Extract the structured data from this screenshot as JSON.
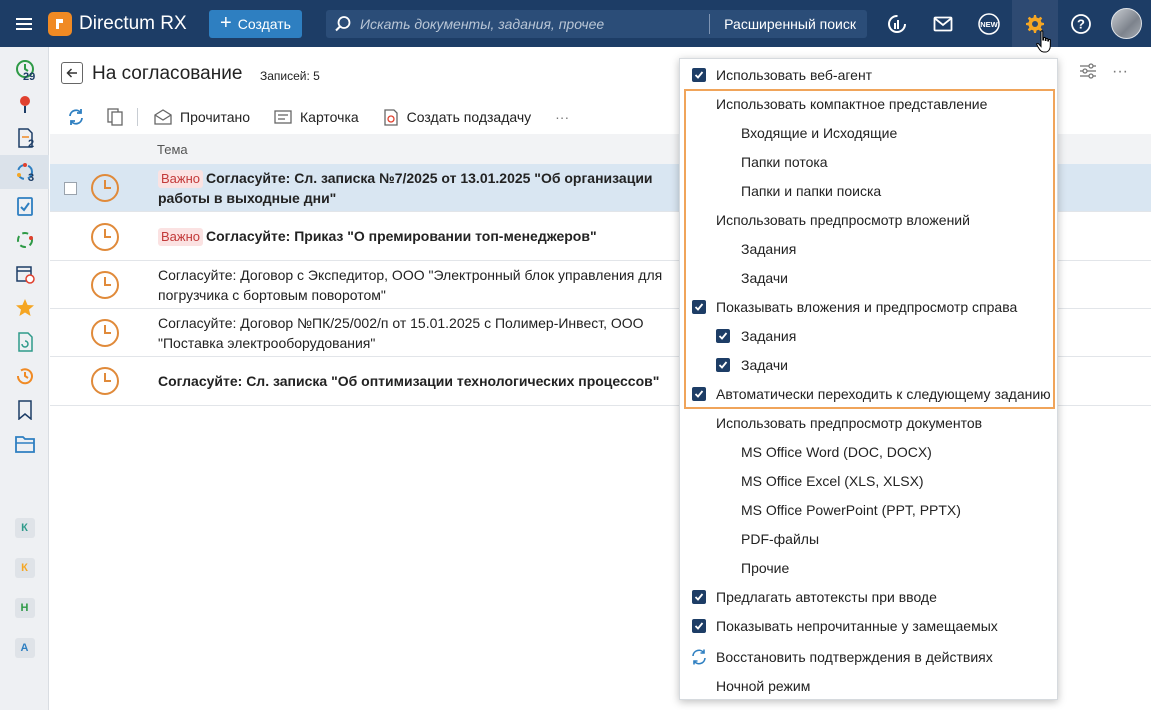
{
  "app": {
    "name": "Directum RX"
  },
  "topbar": {
    "create_label": "Создать",
    "search_placeholder": "Искать документы, задания, прочее",
    "advanced_search_label": "Расширенный поиск",
    "new_badge": "NEW"
  },
  "sidebar": {
    "badges": {
      "tasks": "29",
      "documents": "2",
      "approvals": "3"
    },
    "letters": [
      "К",
      "К",
      "Н",
      "А"
    ]
  },
  "main": {
    "title": "На согласование",
    "record_count": "Записей: 5",
    "toolbar": {
      "read_label": "Прочитано",
      "card_label": "Карточка",
      "subtask_label": "Создать подзадачу",
      "more_label": "···"
    },
    "column_subject": "Тема",
    "rows": [
      {
        "important": "Важно",
        "subject": "Согласуйте: Сл. записка №7/2025 от 13.01.2025 \"Об организации работы в выходные дни\"",
        "bold": true,
        "selected": true
      },
      {
        "important": "Важно",
        "subject": "Согласуйте: Приказ \"О премировании топ-менеджеров\"",
        "bold": true,
        "selected": false
      },
      {
        "important": "",
        "subject": "Согласуйте: Договор с Экспедитор, ООО \"Электронный блок управления для погрузчика с бортовым поворотом\"",
        "bold": false,
        "selected": false
      },
      {
        "important": "",
        "subject": "Согласуйте: Договор №ПК/25/002/п от 15.01.2025 с Полимер-Инвест, ООО \"Поставка электрооборудования\"",
        "bold": false,
        "selected": false
      },
      {
        "important": "",
        "subject": "Согласуйте: Сл. записка \"Об оптимизации технологических процессов\"",
        "bold": true,
        "selected": false
      }
    ]
  },
  "settings_menu": {
    "items": [
      {
        "label": "Использовать веб-агент",
        "checked": true,
        "indent": 0
      },
      {
        "label": "Использовать компактное представление",
        "checked": false,
        "indent": 0
      },
      {
        "label": "Входящие и Исходящие",
        "checked": false,
        "indent": 1
      },
      {
        "label": "Папки потока",
        "checked": false,
        "indent": 1
      },
      {
        "label": "Папки и папки поиска",
        "checked": false,
        "indent": 1
      },
      {
        "label": "Использовать предпросмотр вложений",
        "checked": false,
        "indent": 0
      },
      {
        "label": "Задания",
        "checked": false,
        "indent": 1
      },
      {
        "label": "Задачи",
        "checked": false,
        "indent": 1
      },
      {
        "label": "Показывать вложения и предпросмотр справа",
        "checked": true,
        "indent": 0
      },
      {
        "label": "Задания",
        "checked": true,
        "indent": 1
      },
      {
        "label": "Задачи",
        "checked": true,
        "indent": 1
      },
      {
        "label": "Автоматически переходить к следующему заданию",
        "checked": true,
        "indent": 0
      },
      {
        "label": "Использовать предпросмотр документов",
        "checked": false,
        "indent": 0
      },
      {
        "label": "MS Office Word (DOC, DOCX)",
        "checked": false,
        "indent": 1
      },
      {
        "label": "MS Office Excel (XLS, XLSX)",
        "checked": false,
        "indent": 1
      },
      {
        "label": "MS Office PowerPoint (PPT, PPTX)",
        "checked": false,
        "indent": 1
      },
      {
        "label": "PDF-файлы",
        "checked": false,
        "indent": 1
      },
      {
        "label": "Прочие",
        "checked": false,
        "indent": 1
      },
      {
        "label": "Предлагать автотексты при вводе",
        "checked": true,
        "indent": 0
      },
      {
        "label": "Показывать непрочитанные у замещаемых",
        "checked": true,
        "indent": 0
      },
      {
        "label": "Восстановить подтверждения в действиях",
        "checked": false,
        "indent": 0,
        "icon": "refresh-icon"
      },
      {
        "label": "Ночной режим",
        "checked": false,
        "indent": 0
      }
    ]
  },
  "colors": {
    "header": "#1d3d66",
    "accent": "#2e7fc1",
    "gear": "#f5a623",
    "highlight": "#f0a45a",
    "important_bg": "#fbe2e2"
  }
}
